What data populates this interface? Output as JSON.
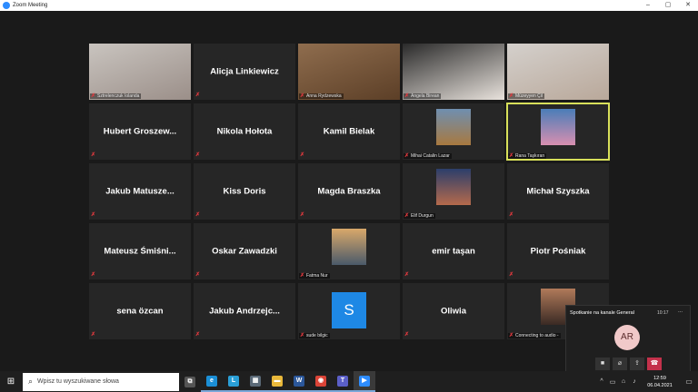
{
  "window": {
    "title": "Zoom Meeting",
    "minimize": "–",
    "maximize": "▢",
    "close": "✕"
  },
  "participants": [
    {
      "name": "Sztrelenczuk Iolanda",
      "mode": "video",
      "colors": [
        "#c9c4bf",
        "#9b8f89"
      ]
    },
    {
      "name": "Alicja Linkiewicz",
      "mode": "name"
    },
    {
      "name": "Anna Rydzewska",
      "mode": "video",
      "colors": [
        "#8f6d4e",
        "#5c3f27"
      ]
    },
    {
      "name": "Angela Birean",
      "mode": "video",
      "colors": [
        "#2a2a2a",
        "#e8e2dc"
      ]
    },
    {
      "name": "Müzeyyen Çil",
      "mode": "video",
      "colors": [
        "#d4d0cc",
        "#b9a89a"
      ]
    },
    {
      "name": "Hubert Groszew...",
      "mode": "name"
    },
    {
      "name": "Nikola Hołota",
      "mode": "name"
    },
    {
      "name": "Kamil Bielak",
      "mode": "name"
    },
    {
      "name": "Mihai Catalin Lazar",
      "mode": "photo",
      "colors": [
        "#6f8fb0",
        "#a8793f"
      ]
    },
    {
      "name": "Rana Taşkıran",
      "mode": "photo",
      "active": true,
      "colors": [
        "#4a7db8",
        "#d88fb0"
      ]
    },
    {
      "name": "Jakub Matusze...",
      "mode": "name"
    },
    {
      "name": "Kiss Doris",
      "mode": "name"
    },
    {
      "name": "Magda Braszka",
      "mode": "name"
    },
    {
      "name": "Elif Durgun",
      "mode": "photo",
      "colors": [
        "#2c3e6b",
        "#b56a4c"
      ]
    },
    {
      "name": "Michał Szyszka",
      "mode": "name"
    },
    {
      "name": "Mateusz Śmiśni...",
      "mode": "name"
    },
    {
      "name": "Oskar Zawadzki",
      "mode": "name"
    },
    {
      "name": "Fatma Nur",
      "mode": "photo",
      "colors": [
        "#d9a86a",
        "#4a5a6a"
      ]
    },
    {
      "name": "emir taşan",
      "mode": "name"
    },
    {
      "name": "Piotr Pośniak",
      "mode": "name"
    },
    {
      "name": "sena özcan",
      "mode": "name"
    },
    {
      "name": "Jakub Andrzejc...",
      "mode": "name"
    },
    {
      "name": "sude bilgic",
      "mode": "avatar",
      "initial": "S"
    },
    {
      "name": "Oliwia",
      "mode": "name"
    },
    {
      "name": "Connecting to audio -",
      "mode": "photo",
      "colors": [
        "#b07a5a",
        "#3a2a24"
      ]
    }
  ],
  "mic_muted_glyph": "✗",
  "panel": {
    "title": "Spotkanie na kanale General",
    "time": "10:17",
    "more": "...",
    "initials": "AR",
    "buttons": [
      "■",
      "⌀",
      "⇪",
      "☎"
    ]
  },
  "taskbar": {
    "start_glyph": "⊞",
    "search_placeholder": "Wpisz tu wyszukiwane słowa",
    "apps": [
      {
        "name": "task-view",
        "glyph": "⧉",
        "color": "#555555"
      },
      {
        "name": "edge",
        "glyph": "e",
        "color": "#1b8fd6"
      },
      {
        "name": "app-l",
        "glyph": "L",
        "color": "#2a9fd6"
      },
      {
        "name": "calculator",
        "glyph": "▦",
        "color": "#5b6a78"
      },
      {
        "name": "file-explorer",
        "glyph": "▬",
        "color": "#e9b83a"
      },
      {
        "name": "word",
        "glyph": "W",
        "color": "#2b579a"
      },
      {
        "name": "chrome",
        "glyph": "◉",
        "color": "#db4437"
      },
      {
        "name": "teams",
        "glyph": "T",
        "color": "#5b5fc7"
      },
      {
        "name": "zoom",
        "glyph": "▶",
        "color": "#2d8cff"
      }
    ],
    "tray": [
      "^",
      "▭",
      "⌂",
      "♪"
    ],
    "time": "12:59",
    "date": "06.04.2021",
    "notifications": "▭"
  }
}
